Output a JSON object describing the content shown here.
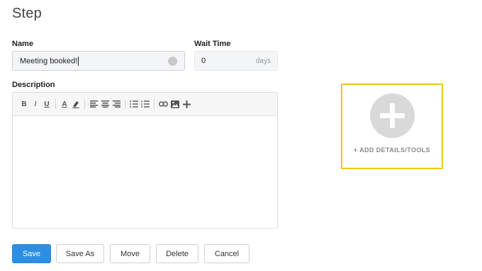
{
  "page": {
    "title": "Step"
  },
  "form": {
    "name_label": "Name",
    "name_value": "Meeting booked!",
    "wait_label": "Wait Time",
    "wait_value": "0",
    "wait_unit": "days",
    "description_label": "Description"
  },
  "toolbar": {
    "bold": "B",
    "italic": "I",
    "underline": "U",
    "font_color": "A"
  },
  "add_panel": {
    "link_label": "+ ADD DETAILS/TOOLS"
  },
  "buttons": {
    "save": "Save",
    "save_as": "Save As",
    "move": "Move",
    "delete": "Delete",
    "cancel": "Cancel"
  },
  "colors": {
    "primary": "#2d8fe3",
    "highlight_border": "#f5c518"
  },
  "icons": [
    "bold-icon",
    "italic-icon",
    "underline-icon",
    "font-color-icon",
    "eraser-icon",
    "align-left-icon",
    "align-center-icon",
    "align-right-icon",
    "bulleted-list-icon",
    "numbered-list-icon",
    "link-icon",
    "image-icon",
    "plus-icon"
  ]
}
